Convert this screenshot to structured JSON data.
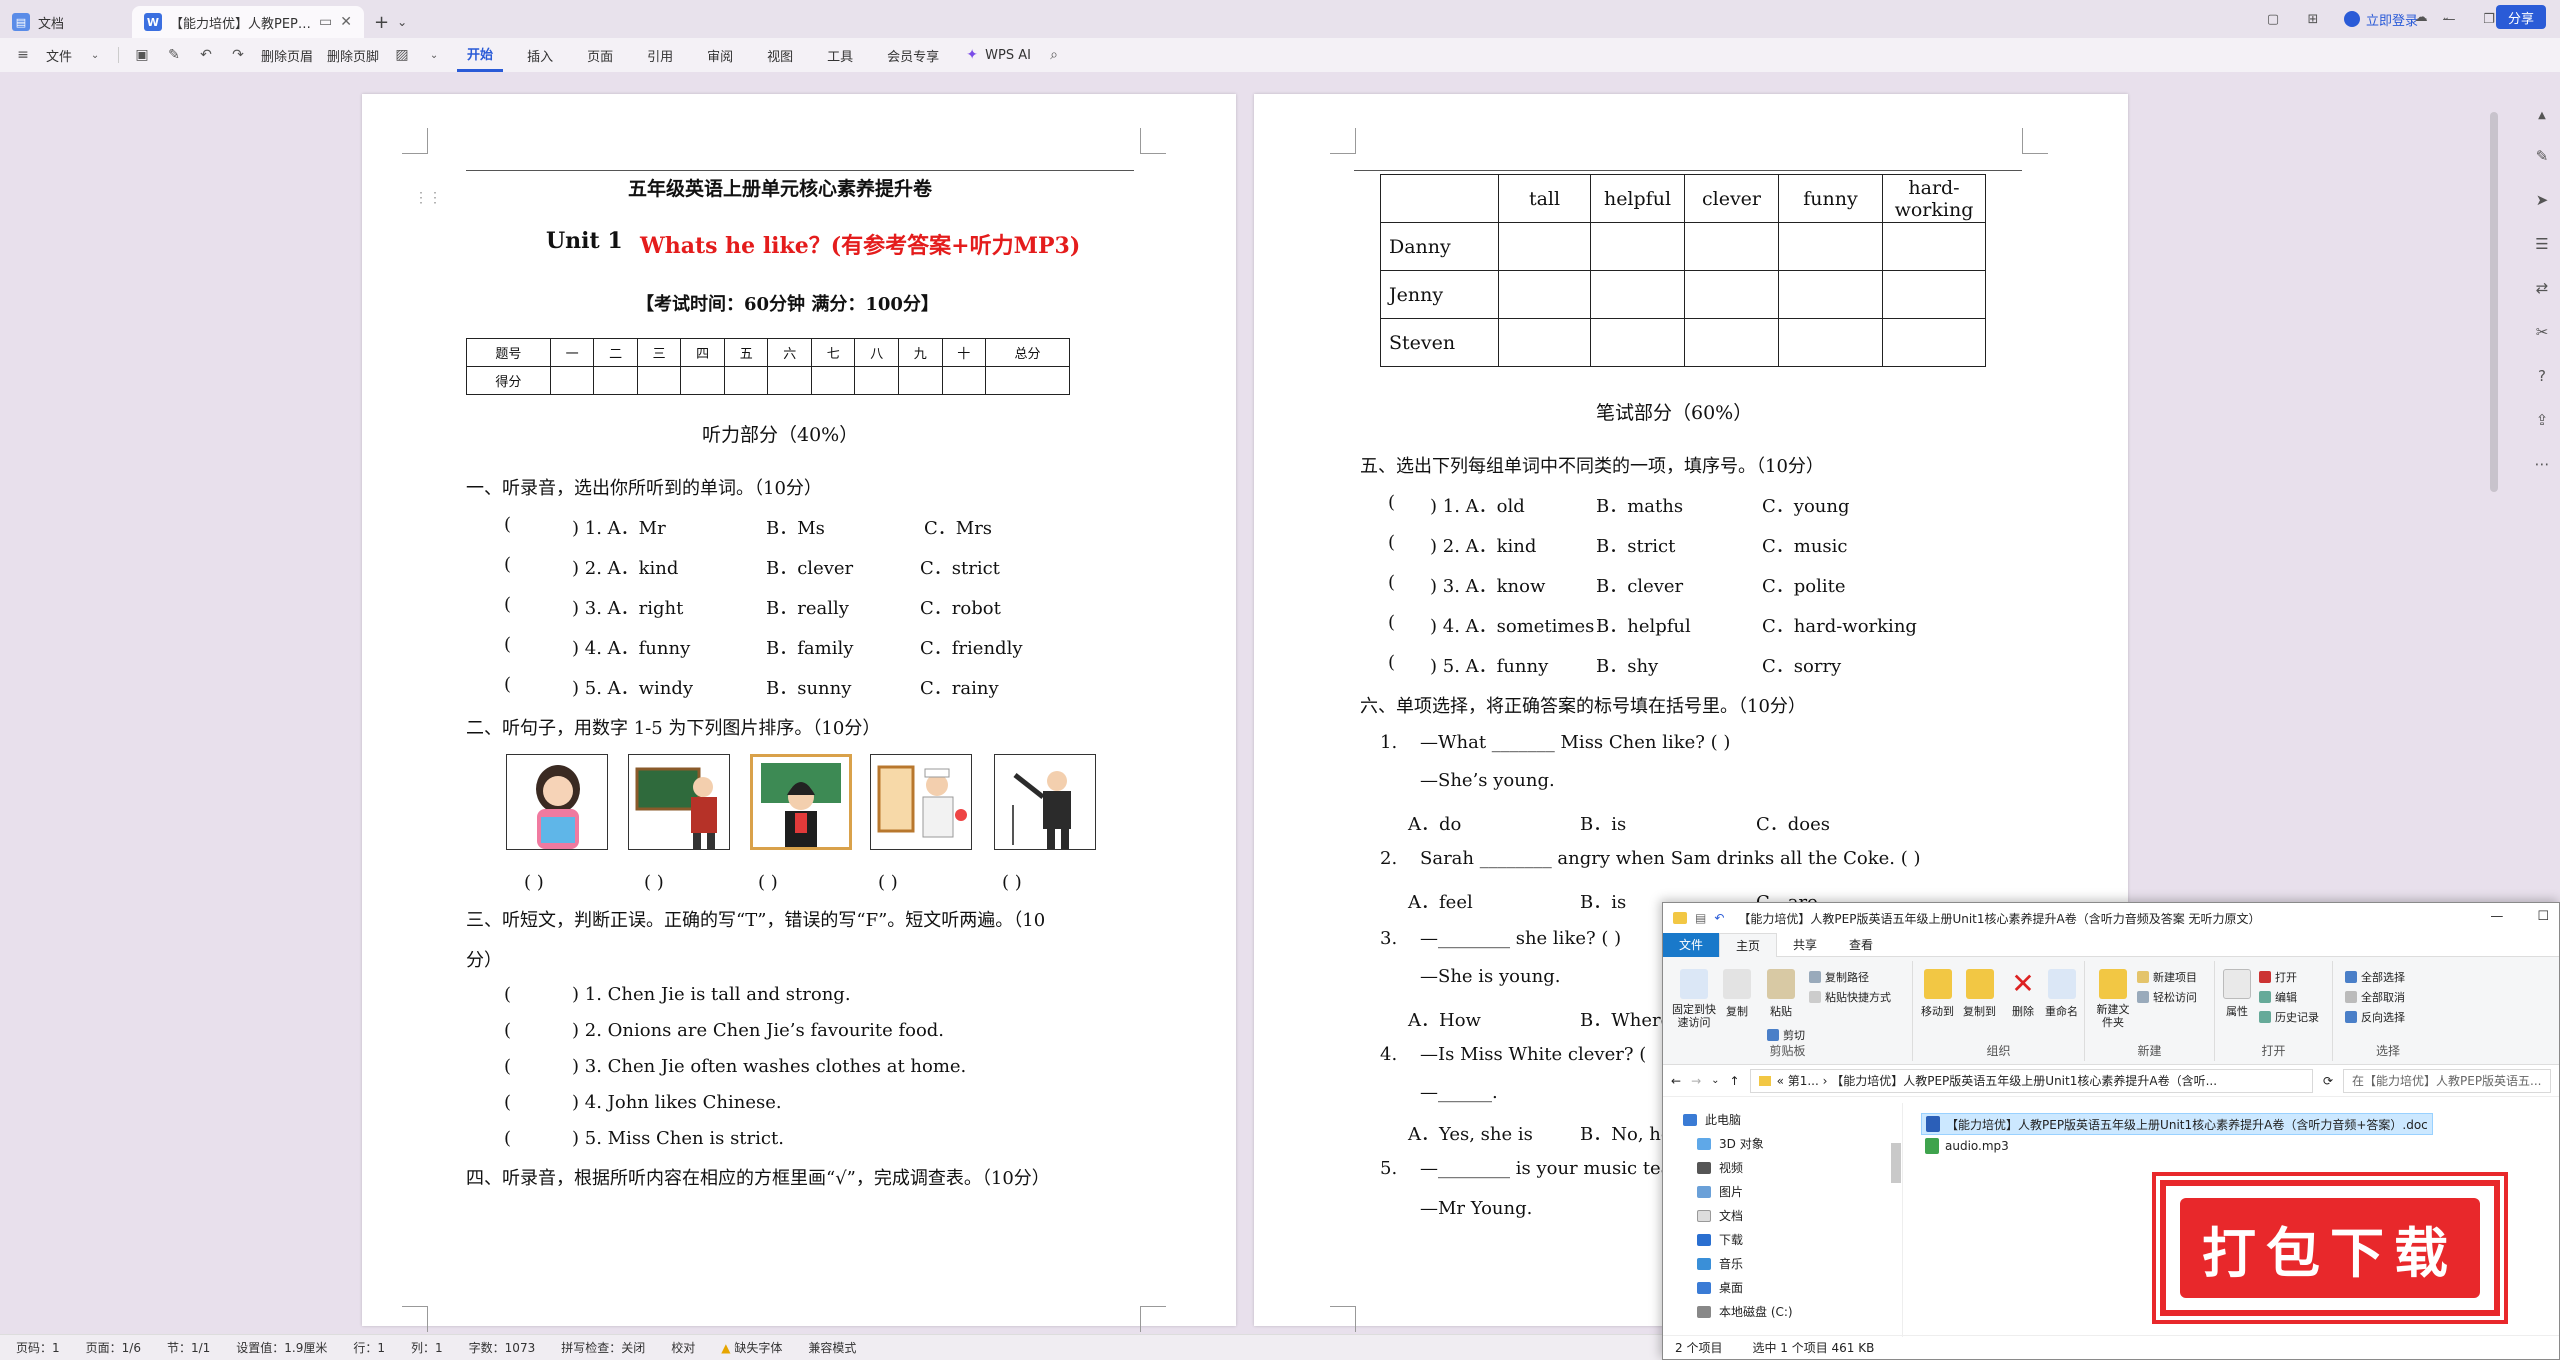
{
  "titlebar": {
    "home_tab": "文档",
    "doc_tab": "【能力培优】人教PEP版英语五",
    "login": "立即登录"
  },
  "ribbon": {
    "file": "文件",
    "delete_header": "删除页眉",
    "delete_footer": "删除页脚",
    "tabs": [
      "开始",
      "插入",
      "页面",
      "引用",
      "审阅",
      "视图",
      "工具",
      "会员专享"
    ],
    "wps_ai": "WPS AI",
    "share": "分享"
  },
  "page1": {
    "title": "五年级英语上册单元核心素养提升卷",
    "unit": "Unit 1",
    "unit_title": "Whats he like？(有参考答案+听力MP3)",
    "exam_info": "【考试时间：60分钟  满分：100分】",
    "score_headers": [
      "题号",
      "一",
      "二",
      "三",
      "四",
      "五",
      "六",
      "七",
      "八",
      "九",
      "十",
      "总分"
    ],
    "score_row_label": "得分",
    "listening": "听力部分（40%）",
    "s1": "一、听录音，选出你所听到的单词。（10分）",
    "s1_items": [
      {
        "p": "(",
        "q": ") 1. A．Mr",
        "b": "B．Ms",
        "c": "C．Mrs"
      },
      {
        "p": "(",
        "q": ") 2. A．kind",
        "b": "B．clever",
        "c": "C．strict"
      },
      {
        "p": "(",
        "q": ") 3. A．right",
        "b": "B．really",
        "c": "C．robot"
      },
      {
        "p": "(",
        "q": ") 4. A．funny",
        "b": "B．family",
        "c": "C．friendly"
      },
      {
        "p": "(",
        "q": ") 5. A．windy",
        "b": "B．sunny",
        "c": "C．rainy"
      }
    ],
    "s2": "二、听句子，用数字 1-5  为下列图片排序。（10分）",
    "s2_brackets": [
      "(          )",
      "(          )",
      "(          )",
      "(          )",
      "(          )"
    ],
    "s3_line1": "三、听短文，判断正误。正确的写“T”，错误的写“F”。短文听两遍。（10",
    "s3_line2": "分）",
    "s3_items": [
      {
        "p": "(",
        "t": ") 1. Chen Jie is tall and strong."
      },
      {
        "p": "(",
        "t": ") 2. Onions are Chen Jie’s favourite food."
      },
      {
        "p": "(",
        "t": ") 3. Chen Jie often washes clothes at home."
      },
      {
        "p": "(",
        "t": ") 4. John likes Chinese."
      },
      {
        "p": "(",
        "t": ") 5. Miss Chen is strict."
      }
    ],
    "s4": "四、听录音，根据所听内容在相应的方框里画“√”，完成调查表。（10分）"
  },
  "page2": {
    "survey_headers": [
      "",
      "tall",
      "helpful",
      "clever",
      "funny",
      "hard-working"
    ],
    "survey_rows": [
      "Danny",
      "Jenny",
      "Steven"
    ],
    "writing": "笔试部分（60%）",
    "s5": "五、选出下列每组单词中不同类的一项，填序号。（10分）",
    "s5_items": [
      {
        "p": "(",
        "q": ") 1. A．old",
        "b": "B．maths",
        "c": "C．young"
      },
      {
        "p": "(",
        "q": ") 2. A．kind",
        "b": "B．strict",
        "c": "C．music"
      },
      {
        "p": "(",
        "q": ") 3. A．know",
        "b": "B．clever",
        "c": "C．polite"
      },
      {
        "p": "(",
        "q": ") 4. A．sometimes",
        "b": "B．helpful",
        "c": "C．hard-working"
      },
      {
        "p": "(",
        "q": ") 5. A．funny",
        "b": "B．shy",
        "c": "C．sorry"
      }
    ],
    "s6": "六、单项选择，将正确答案的标号填在括号里。（10分）",
    "q1_num": "1.",
    "q1": "—What _______ Miss Chen like? (          )",
    "q1b": "—She’s young.",
    "q1_opts": [
      "A．do",
      "B．is",
      "C．does"
    ],
    "q2_num": "2.",
    "q2": "Sarah ________ angry when Sam drinks all the Coke.  (      )",
    "q2_opts": [
      "A．feel",
      "B．is",
      "C．are"
    ],
    "q3_num": "3.",
    "q3": "—________ she like? (      )",
    "q3b": "—She is young.",
    "q3_opts": [
      "A．How",
      "B．Where"
    ],
    "q4_num": "4.",
    "q4": "—Is Miss White clever? (",
    "q4b": "—______.",
    "q4_opts": [
      "A．Yes, she is",
      "B．No, he"
    ],
    "q5_num": "5.",
    "q5": "—________ is your music tea",
    "q5b": "—Mr Young."
  },
  "status": {
    "items": [
      "页码：1",
      "页面：1/6",
      "节：1/1",
      "设置值：1.9厘米",
      "行：1",
      "列：1",
      "字数：1073",
      "拼写检查：关闭",
      "校对",
      "缺失字体",
      "兼容模式"
    ]
  },
  "explorer": {
    "title": "【能力培优】人教PEP版英语五年级上册Unit1核心素养提升A卷（含听力音频及答案 无听力原文）",
    "tabs": [
      "文件",
      "主页",
      "共享",
      "查看"
    ],
    "clipboard": {
      "pin": "固定到快速访问",
      "copy": "复制",
      "paste": "粘贴",
      "copy_path": "复制路径",
      "paste_shortcut": "粘贴快捷方式",
      "cut": "剪切",
      "label": "剪贴板"
    },
    "organize": {
      "move": "移动到",
      "copyto": "复制到",
      "delete": "删除",
      "rename": "重命名",
      "label": "组织"
    },
    "new": {
      "folder": "新建文件夹",
      "new_item": "新建项目",
      "easy_access": "轻松访问",
      "label": "新建"
    },
    "open": {
      "properties": "属性",
      "open": "打开",
      "edit": "编辑",
      "history": "历史记录",
      "label": "打开"
    },
    "select": {
      "all": "全部选择",
      "none": "全部取消",
      "invert": "反向选择",
      "label": "选择"
    },
    "address": "«  第1...  ›  【能力培优】人教PEP版英语五年级上册Unit1核心素养提升A卷（含听...",
    "search": "在【能力培优】人教PEP版英语五...",
    "nav": [
      "此电脑",
      "3D 对象",
      "视频",
      "图片",
      "文档",
      "下载",
      "音乐",
      "桌面",
      "本地磁盘 (C:)"
    ],
    "files": [
      "【能力培优】人教PEP版英语五年级上册Unit1核心素养提升A卷（含听力音频+答案）.doc",
      "audio.mp3"
    ],
    "count": "2 个项目",
    "selected": "选中 1 个项目  461 KB"
  },
  "banner": {
    "text": "打包下载"
  }
}
